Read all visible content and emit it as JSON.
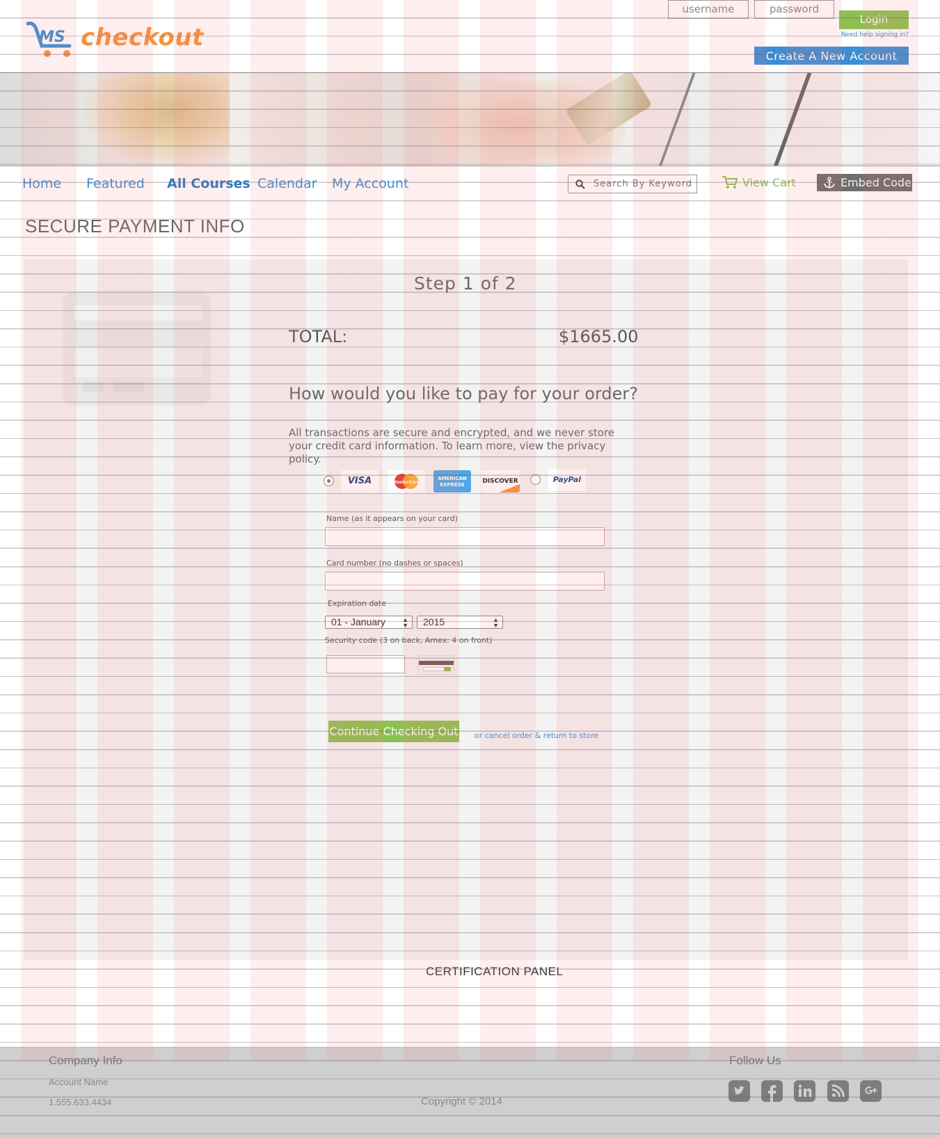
{
  "header": {
    "logo_text": "checkout",
    "logo_mark_text": "MS",
    "login": {
      "username_placeholder": "username",
      "password_placeholder": "password",
      "login_label": "Login",
      "help_link": "Need help signing in?",
      "create_account_label": "Create  A  New  Account"
    }
  },
  "nav": {
    "items": [
      {
        "label": "Home",
        "active": false
      },
      {
        "label": "Featured",
        "active": false
      },
      {
        "label": "All Courses",
        "active": true
      },
      {
        "label": "Calendar",
        "active": false
      },
      {
        "label": "My Account",
        "active": false
      }
    ],
    "search_placeholder": "Search By Keyword",
    "view_cart_label": "View Cart",
    "embed_code_label": "Embed Code"
  },
  "page": {
    "title": "SECURE PAYMENT INFO"
  },
  "checkout": {
    "step_text": "Step 1 of 2",
    "total_label": "TOTAL:",
    "total_value": "$1665.00",
    "question": "How would you like to pay for your order?",
    "secure_text": "All transactions are secure and encrypted, and we never store your credit card information.  To learn more, view the privacy policy.",
    "payment_options": {
      "card_selected": true,
      "cards": [
        "VISA",
        "MasterCard",
        "AMERICAN EXPRESS",
        "DISCOVER"
      ],
      "paypal_label": "PayPal"
    },
    "fields": {
      "name_label": "Name (as it appears on your card)",
      "name_value": "",
      "card_number_label": "Card number (no dashes or spaces)",
      "card_number_value": "",
      "expiration_label": "Expiration date",
      "month_value": "01 - January",
      "year_value": "2015",
      "security_label": "Security code (3 on back, Amex: 4 on front)",
      "security_value": ""
    },
    "continue_label": "Continue Checking Out",
    "cancel_link": "or cancel order & return to store"
  },
  "certification": {
    "label": "CERTIFICATION PANEL"
  },
  "footer": {
    "company_heading": "Company Info",
    "account_name": "Account Name",
    "phone": "1.555.633.4434",
    "copyright": "Copyright © 2014",
    "follow_heading": "Follow Us",
    "social": [
      "twitter-icon",
      "facebook-icon",
      "linkedin-icon",
      "rss-icon",
      "google-plus-icon"
    ]
  },
  "colors": {
    "accent_blue": "#3b8fd5",
    "accent_green": "#8cc152",
    "logo_orange": "#f5923e"
  }
}
